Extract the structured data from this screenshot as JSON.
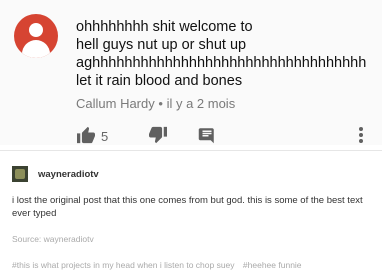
{
  "youtube_comment": {
    "text": "ohhhhhhhh shit welcome to\nhell guys nut up or shut up\naghhhhhhhhhhhhhhhhhhhhhhhhhhhhhhhhhh\nlet it rain blood and bones",
    "author": "Callum Hardy",
    "separator": "•",
    "time_ago": "il y a 2 mois",
    "like_count": "5",
    "icons": [
      "avatar-person-icon",
      "thumbs-up-icon",
      "thumbs-down-icon",
      "reply-icon",
      "more-vert-icon"
    ],
    "colors": {
      "avatar_bg": "#d64432",
      "icon": "#606060"
    }
  },
  "tumblr_post": {
    "blog_name": "wayneradiotv",
    "body": "i lost the original post that this one comes from but god. this is some of the best text ever typed",
    "source": "Source: wayneradiotv",
    "tags": [
      "#this is what projects in my head when i listen to chop suey",
      "#heehee funnie"
    ]
  }
}
